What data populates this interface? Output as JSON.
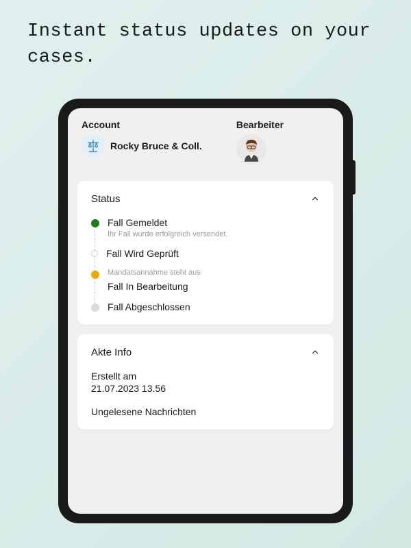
{
  "headline": "Instant status updates on your cases.",
  "header": {
    "account_label": "Account",
    "account_name": "Rocky Bruce & Coll.",
    "bearbeiter_label": "Bearbeiter"
  },
  "status_card": {
    "title": "Status",
    "items": [
      {
        "label": "Fall Gemeldet",
        "sub": "Ihr Fall wurde erfolgreich versendet.",
        "color": "green"
      },
      {
        "label": "Fall Wird Geprüft",
        "sub": "Mandatsannahme steht aus",
        "color": "orange"
      },
      {
        "label": "Fall In Bearbeitung",
        "sub": "",
        "color": "hollow"
      },
      {
        "label": "Fall Abgeschlossen",
        "sub": "",
        "color": "grey"
      }
    ]
  },
  "info_card": {
    "title": "Akte Info",
    "created_label": "Erstellt am",
    "created_value": "21.07.2023  13.56",
    "unread_label": "Ungelesene Nachrichten"
  },
  "colors": {
    "green": "#1a7d1a",
    "orange": "#f0a800",
    "grey": "#d9d9d9"
  }
}
